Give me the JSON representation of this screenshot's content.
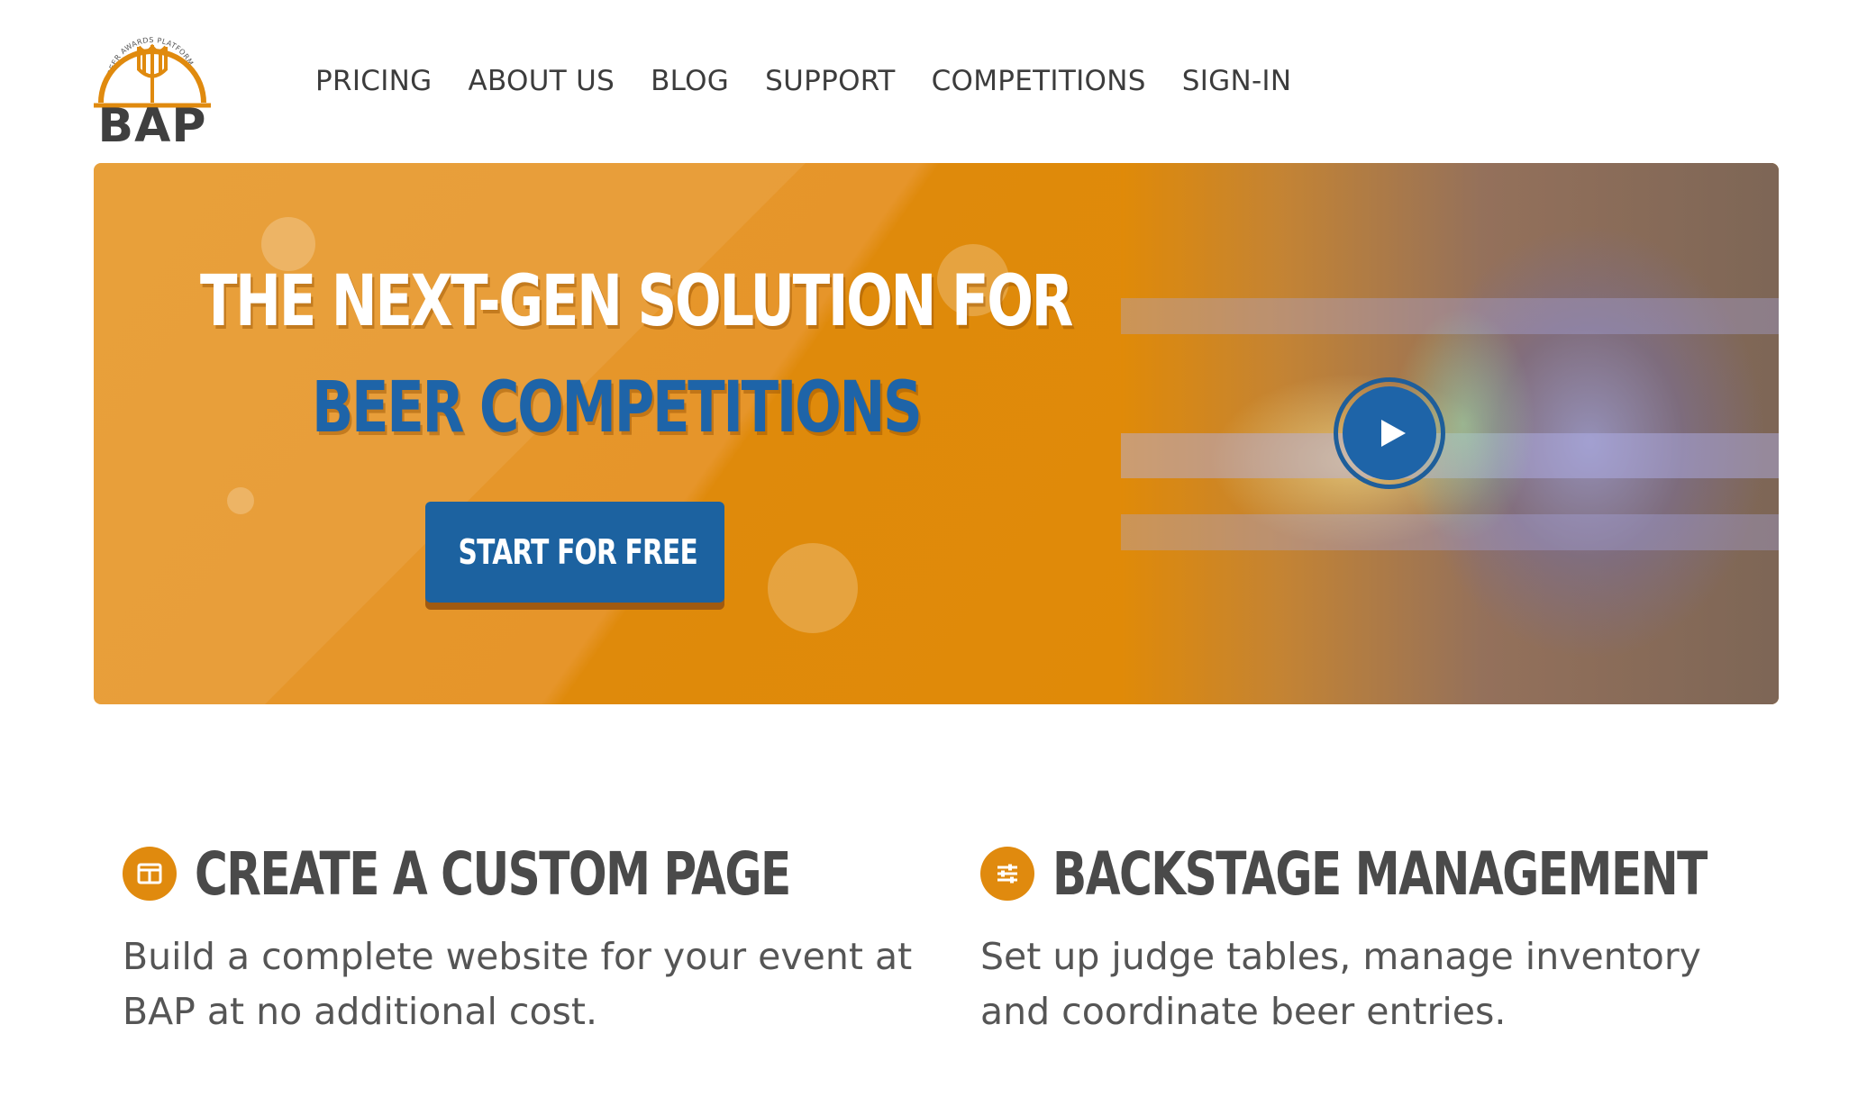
{
  "logo": {
    "arc_text": "BEER AWARDS PLATFORM",
    "text": "BAP",
    "icon": "wheat-shield-icon",
    "color": "#e08a0e"
  },
  "nav": {
    "items": [
      {
        "label": "PRICING"
      },
      {
        "label": "ABOUT US"
      },
      {
        "label": "BLOG"
      },
      {
        "label": "SUPPORT"
      },
      {
        "label": "COMPETITIONS"
      },
      {
        "label": "SIGN-IN"
      }
    ]
  },
  "hero": {
    "headline_line1": "THE NEXT-GEN SOLUTION FOR",
    "headline_line2": "BEER COMPETITIONS",
    "cta_label": "START FOR FREE",
    "play_icon": "play-icon",
    "colors": {
      "background": "#e08a08",
      "accent": "#1e64a8",
      "text": "#ffffff"
    }
  },
  "features": [
    {
      "icon": "layout-icon",
      "title": "CREATE A CUSTOM PAGE",
      "description": "Build a complete website for your event at BAP at no additional cost."
    },
    {
      "icon": "sliders-icon",
      "title": "BACKSTAGE MANAGEMENT",
      "description": "Set up judge tables, manage inventory and coordinate beer entries."
    }
  ]
}
